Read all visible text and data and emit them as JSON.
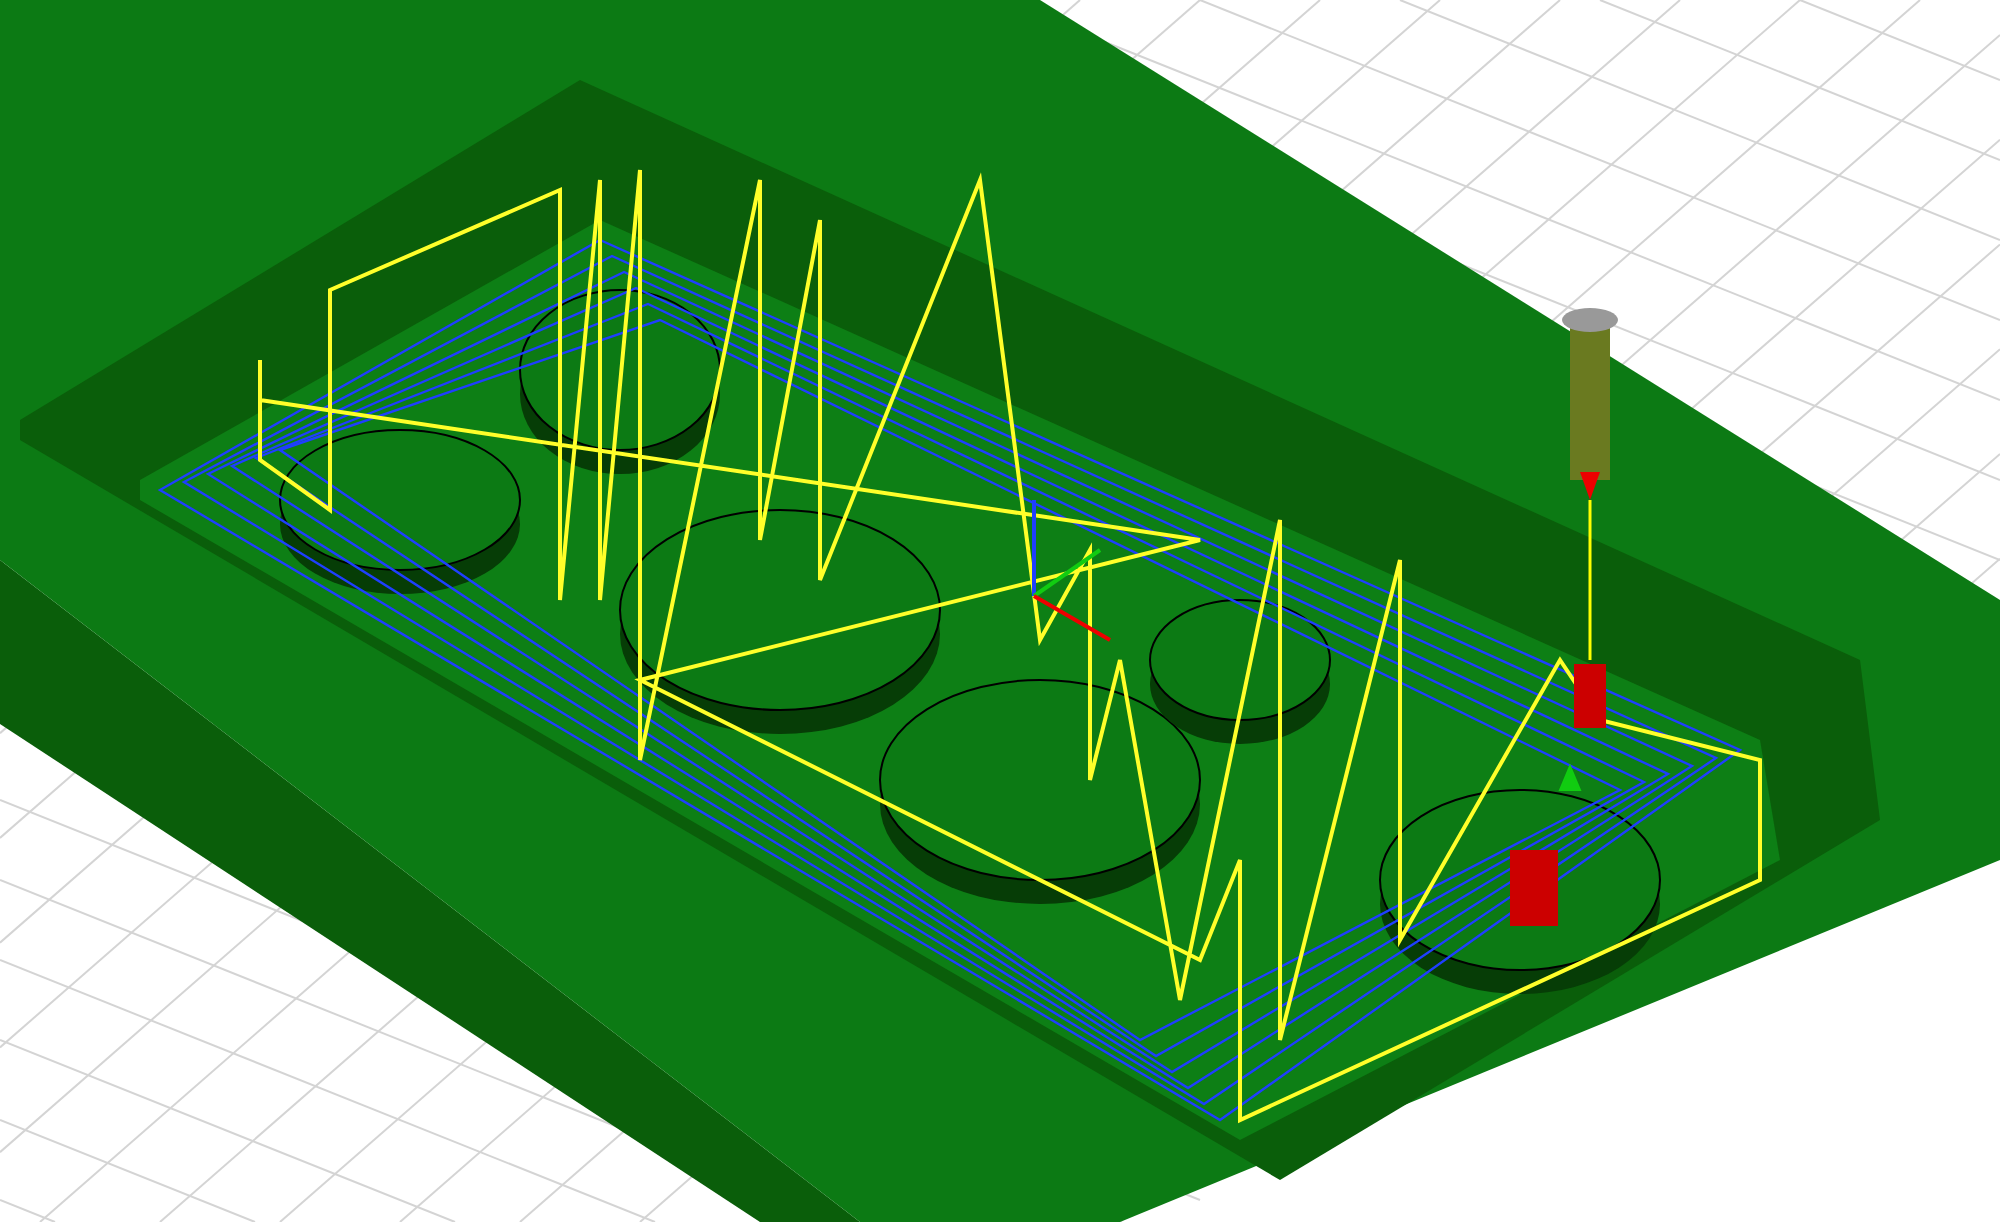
{
  "viewport": {
    "grid_visible": true,
    "toolpath_visible": true,
    "tool_visible": true
  }
}
